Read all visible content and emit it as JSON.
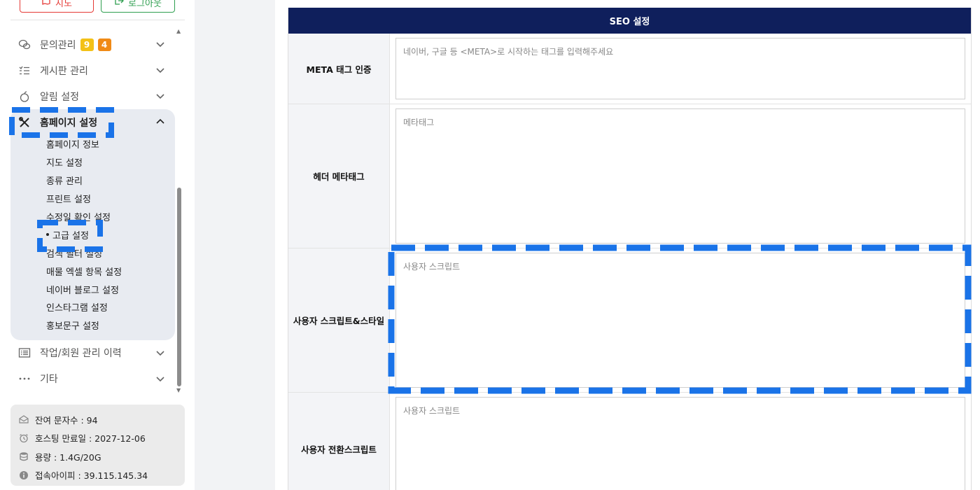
{
  "top_buttons": {
    "map_label": "지도",
    "logout_label": "로그아웃"
  },
  "menu": {
    "inquiry": {
      "label": "문의관리",
      "badge_yellow": "9",
      "badge_orange": "4"
    },
    "board": {
      "label": "게시판 관리"
    },
    "notify": {
      "label": "알림 설정"
    },
    "homepage": {
      "label": "홈페이지 설정",
      "items": [
        "홈페이지 정보",
        "지도 설정",
        "종류 관리",
        "프린트 설정",
        "수정일 확인 설정",
        "고급 설정",
        "검색 필터 설정",
        "매물 엑셀 항목 설정",
        "네이버 블로그 설정",
        "인스타그램 설정",
        "홍보문구 설정"
      ],
      "active_index": 5
    },
    "history": {
      "label": "작업/회원 관리 이력"
    },
    "etc": {
      "label": "기타"
    }
  },
  "info": {
    "sms": "잔여 문자수 : 94",
    "hosting": "호스팅 만료일 : 2027-12-06",
    "storage": "용량 : 1.4G/20G",
    "ip": "접속아이피 : 39.115.145.34"
  },
  "seo": {
    "title": "SEO 설정",
    "rows": [
      {
        "label": "META 태그 인증",
        "placeholder": "네이버, 구글 등 <META>로 시작하는 태그를 입력해주세요"
      },
      {
        "label": "헤더 메타태그",
        "placeholder": "메타태그"
      },
      {
        "label": "사용자 스크립트&스타일",
        "placeholder": "사용자 스크립트"
      },
      {
        "label": "사용자 전환스크립트",
        "placeholder": "사용자 스크립트"
      }
    ]
  },
  "colors": {
    "header_navy": "#0f1f5c",
    "highlight_blue": "#1a73e8",
    "badge_yellow": "#f3c117",
    "badge_orange": "#f08a16"
  }
}
